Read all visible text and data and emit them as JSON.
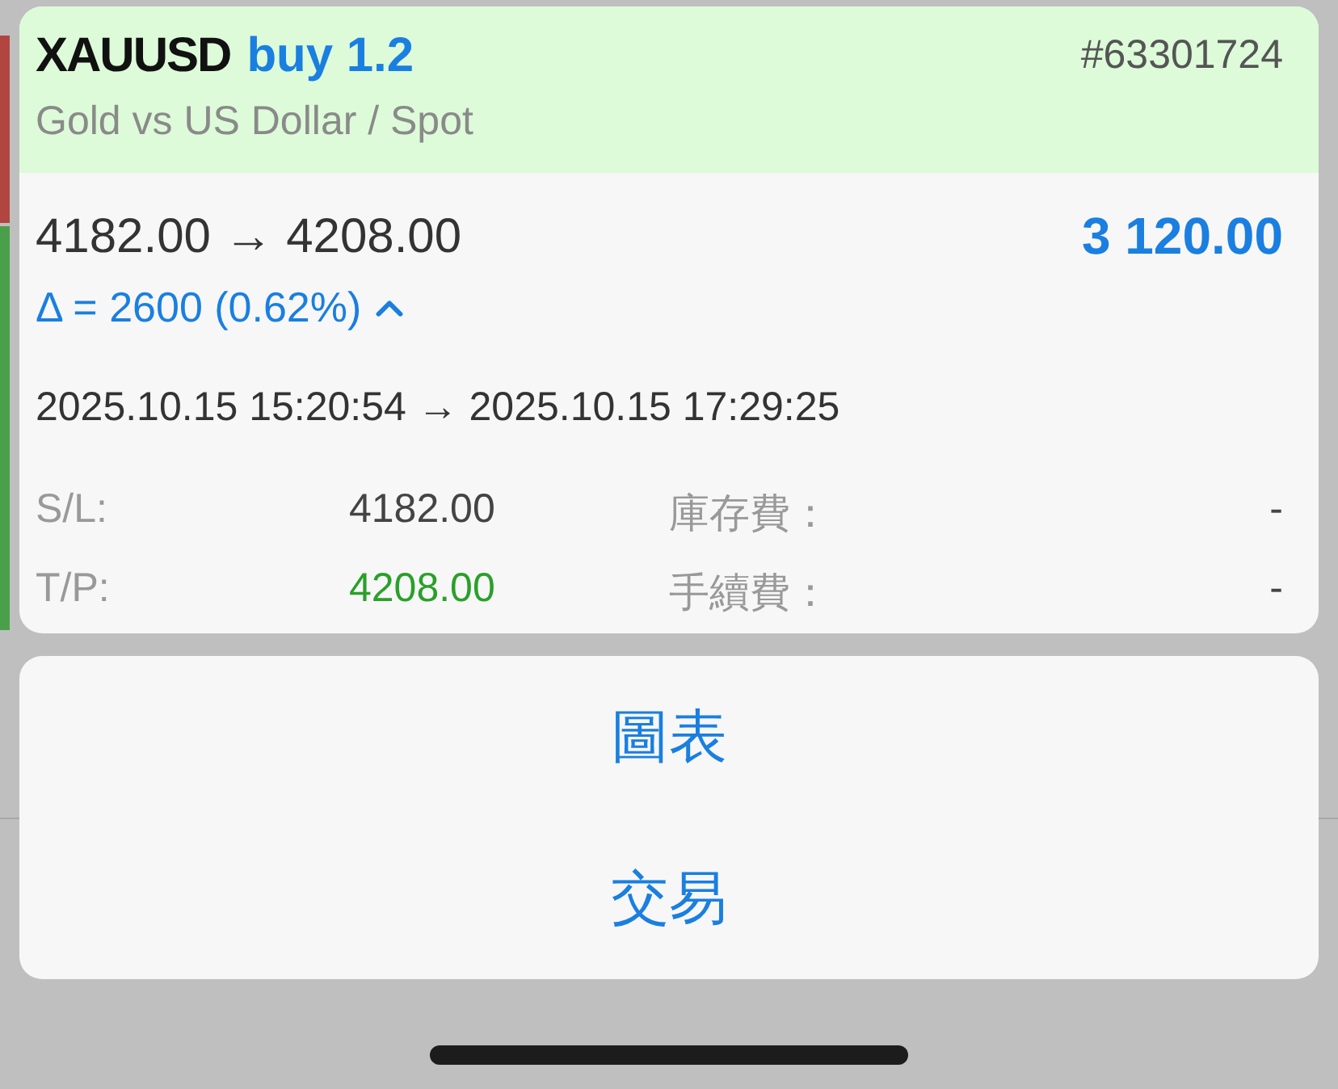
{
  "trade": {
    "symbol": "XAUUSD",
    "side": "buy 1.2",
    "ticket": "#63301724",
    "description": "Gold vs US Dollar / Spot",
    "prices": "4182.00 → 4208.00",
    "profit": "3 120.00",
    "delta": "Δ = 2600 (0.62%)",
    "expanded": true,
    "times": "2025.10.15 15:20:54 → 2025.10.15 17:29:25",
    "details": [
      {
        "label": "S/L:",
        "value": "4182.00",
        "kind": "plain",
        "label_2": "庫存費：",
        "value_2": "-"
      },
      {
        "label": "T/P:",
        "value": "4208.00",
        "kind": "positive",
        "label_2": "手續費：",
        "value_2": "-"
      }
    ]
  },
  "actions": [
    "圖表",
    "交易"
  ]
}
